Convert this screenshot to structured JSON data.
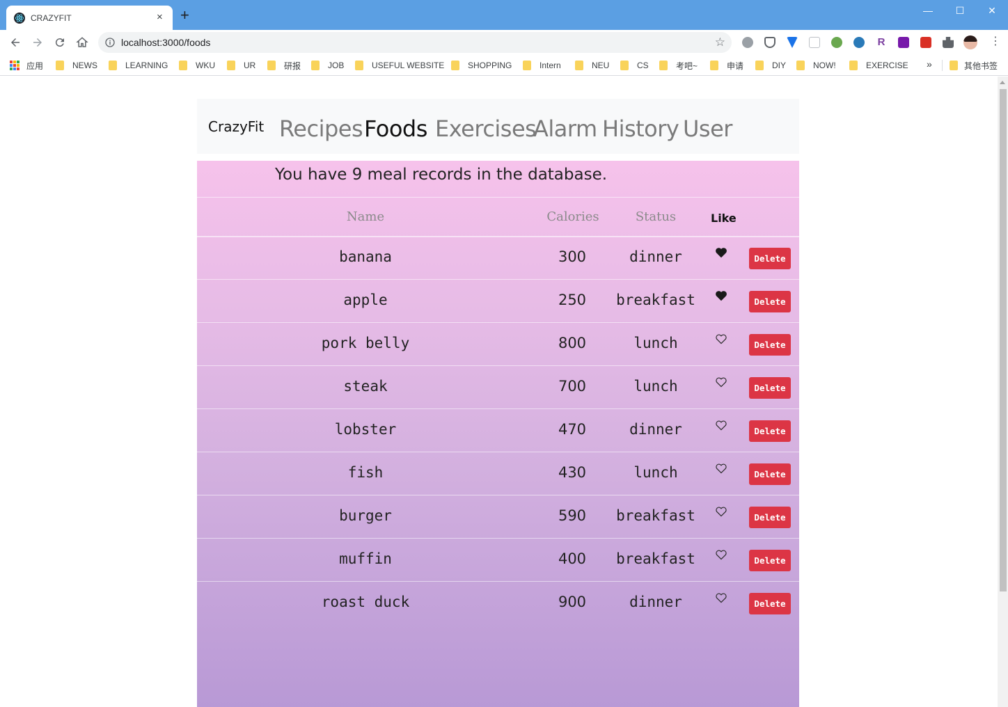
{
  "browser": {
    "tab_title": "CRAZYFIT",
    "tab_close": "×",
    "new_tab": "+",
    "url": "localhost:3000/foods",
    "window_minimize": "—",
    "window_maximize": "☐",
    "window_close": "✕",
    "bookmarks_overflow": "»",
    "bookmarks": [
      {
        "label": "应用",
        "icon": "apps-icon"
      },
      {
        "label": "NEWS",
        "icon": "folder-icon"
      },
      {
        "label": "LEARNING",
        "icon": "folder-icon"
      },
      {
        "label": "WKU",
        "icon": "folder-icon"
      },
      {
        "label": "UR",
        "icon": "folder-icon"
      },
      {
        "label": "研报",
        "icon": "folder-icon"
      },
      {
        "label": "JOB",
        "icon": "folder-icon"
      },
      {
        "label": "USEFUL WEBSITE",
        "icon": "folder-icon"
      },
      {
        "label": "SHOPPING",
        "icon": "folder-icon"
      },
      {
        "label": "Intern",
        "icon": "folder-icon"
      },
      {
        "label": "NEU",
        "icon": "folder-icon"
      },
      {
        "label": "CS",
        "icon": "folder-icon"
      },
      {
        "label": "考吧~",
        "icon": "folder-icon"
      },
      {
        "label": "申请",
        "icon": "folder-icon"
      },
      {
        "label": "DIY",
        "icon": "folder-icon"
      },
      {
        "label": "NOW!",
        "icon": "folder-icon"
      },
      {
        "label": "EXERCISE",
        "icon": "folder-icon"
      }
    ],
    "other_bookmarks": "其他书签"
  },
  "navbar": {
    "brand": "CrazyFit",
    "links": [
      {
        "label": "Recipes",
        "active": false
      },
      {
        "label": "Foods",
        "active": true
      },
      {
        "label": "Exercises",
        "active": false
      },
      {
        "label": "Alarm",
        "active": false
      },
      {
        "label": "History",
        "active": false
      },
      {
        "label": "User",
        "active": false
      }
    ]
  },
  "summary": "You have 9 meal records in the database.",
  "table": {
    "headers": {
      "name": "Name",
      "calories": "Calories",
      "status": "Status",
      "like": "Like"
    },
    "delete_label": "Delete",
    "rows": [
      {
        "name": "banana",
        "calories": "300",
        "status": "dinner",
        "liked": true
      },
      {
        "name": "apple",
        "calories": "250",
        "status": "breakfast",
        "liked": true
      },
      {
        "name": "pork belly",
        "calories": "800",
        "status": "lunch",
        "liked": false
      },
      {
        "name": "steak",
        "calories": "700",
        "status": "lunch",
        "liked": false
      },
      {
        "name": "lobster",
        "calories": "470",
        "status": "dinner",
        "liked": false
      },
      {
        "name": "fish",
        "calories": "430",
        "status": "lunch",
        "liked": false
      },
      {
        "name": "burger",
        "calories": "590",
        "status": "breakfast",
        "liked": false
      },
      {
        "name": "muffin",
        "calories": "400",
        "status": "breakfast",
        "liked": false
      },
      {
        "name": "roast duck",
        "calories": "900",
        "status": "dinner",
        "liked": false
      }
    ]
  },
  "colors": {
    "titlebar": "#5b9fe3",
    "delete_button": "#dc3545",
    "gradient_top": "#f6c2eb",
    "gradient_bottom": "#b798d5"
  }
}
